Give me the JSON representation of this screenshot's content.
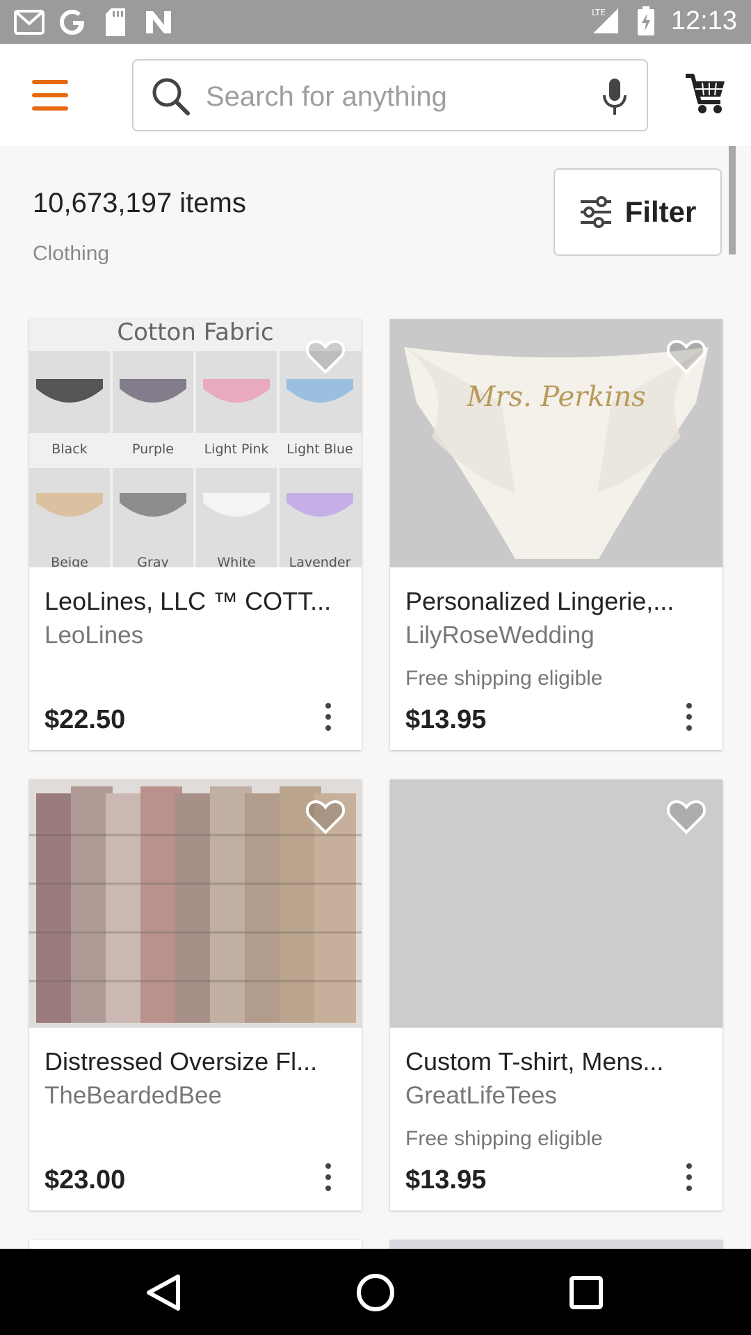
{
  "status_bar": {
    "time": "12:13",
    "left_icons": [
      "gmail-icon",
      "google-icon",
      "sd-card-icon",
      "n-app-icon"
    ],
    "right_icons": [
      "lte-signal-icon",
      "battery-charging-icon"
    ]
  },
  "header": {
    "menu_icon": "hamburger-menu-icon",
    "search_placeholder": "Search for anything",
    "cart_icon": "shopping-cart-icon",
    "accent_color": "#e66a0f"
  },
  "results": {
    "count_label": "10,673,197 items",
    "category_label": "Clothing",
    "filter_label": "Filter"
  },
  "listings": [
    {
      "title": "LeoLines, LLC ™ COTT...",
      "shop": "LeoLines",
      "shipping": "",
      "price": "$22.50",
      "image": {
        "heading": "Cotton Fabric",
        "swatches": [
          "Black",
          "Purple",
          "Light Pink",
          "Light Blue",
          "Beige",
          "Gray",
          "White",
          "Lavender"
        ]
      }
    },
    {
      "title": "Personalized Lingerie,...",
      "shop": "LilyRoseWedding",
      "shipping": "Free shipping eligible",
      "price": "$13.95",
      "image": {
        "script_text": "Mrs. Perkins"
      }
    },
    {
      "title": "Distressed Oversize Fl...",
      "shop": "TheBeardedBee",
      "shipping": "",
      "price": "$23.00"
    },
    {
      "title": "Custom T-shirt, Mens...",
      "shop": "GreatLifeTees",
      "shipping": "Free shipping eligible",
      "price": "$13.95"
    }
  ],
  "nav_bar": {
    "back_icon": "back-triangle-icon",
    "home_icon": "home-circle-icon",
    "recents_icon": "recents-square-icon"
  }
}
